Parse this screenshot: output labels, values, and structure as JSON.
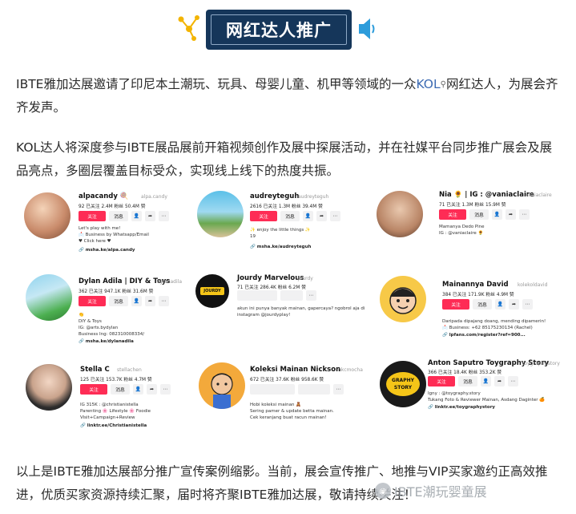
{
  "header": {
    "title": "网红达人推广",
    "left_icon": "network-icon",
    "right_icon": "speaker-icon",
    "accent": "#15365a",
    "deco_color": "#f3b400"
  },
  "paragraphs": {
    "p1_before": "IBTE雅加达展邀请了印尼本土潮玩、玩具、母婴儿童、机甲等领域的一众",
    "p1_link": "KOL",
    "p1_after": "网红达人，为展会齐齐发声。",
    "p2": "KOL达人将深度参与IBTE展品展前开箱视频创作及展中探展活动，并在社媒平台同步推广展会及展品亮点，多圈层覆盖目标受众，实现线上线下的热度共振。",
    "p3": "以上是IBTE雅加达展部分推广宣传案例缩影。当前，展会宣传推广、地推与VIP买家邀约正高效推进，优质买家资源持续汇聚，届时将齐聚IBTE雅加达展，敬请持续关注！"
  },
  "buttons": {
    "follow": "关注",
    "message": "消息"
  },
  "profiles": [
    {
      "name": "alpacandy 🍭",
      "handle": "alpa.candy",
      "stats": "92 已关注   2.4M 粉丝   50.4M 赞",
      "bio": "Let's play with me!\n📩 Business by Whatsapp/Email\n♥ Click here ♥",
      "link": "🔗 msha.ke/alpa.candy"
    },
    {
      "name": "audreyteguh",
      "handle": "audreyteguh",
      "stats": "2616 已关注   1.3M 粉丝   39.4M 赞",
      "bio": "✨ enjoy the little things ✨\n19",
      "link": "🔗 msha.ke/audreyteguh"
    },
    {
      "name": "Nia 🌻 | IG : @vaniaclaire",
      "handle": "vaniaclaire",
      "stats": "71 已关注   1.3M 粉丝   15.9M 赞",
      "bio": "Mamanya Dedo Pine\nIG : @vaniaclaire 🌻",
      "link": ""
    },
    {
      "name": "Dylan Adila | DIY & Toys",
      "handle": "dylanadila",
      "stats": "362 已关注   947.1K 粉丝   31.6M 赞",
      "bio": "👏\nDIY & Toys\nIG: @arts.bydylan\nBusiness Ing: 082310008334/",
      "link": "🔗 msha.ke/dylanadila"
    },
    {
      "name": "Jourdy Marvelous",
      "handle": "jourdy",
      "stats": "71 已关注   286.4K 粉丝   6.2M 赞",
      "bio": "akun ini punya banyak mainan, gapercaya? ngobrol aja di instagram @jourdyplay!",
      "link": ""
    },
    {
      "name": "Mainannya David",
      "handle": "kolekoldavid",
      "stats": "384 已关注   171.9K 粉丝   4.9M 赞",
      "bio": "Daripada dipajang doang, mending dipamerin!\n📩 Business: +62 85175230134 (Rachel)",
      "link": "🔗 lpfans.com/register?ref=900..."
    },
    {
      "name": "Stella C",
      "handle": "stellachen",
      "stats": "125 已关注   153.7K 粉丝   4.7M 赞",
      "bio": "IG 315K : @christianistella\nParenting 🌸 Lifestyle 🌸 Foodie\nVisit+Campaign+Review",
      "link": "🔗 linktr.ee/Christianistella"
    },
    {
      "name": "Koleksi Mainan Nickson",
      "handle": "nkcmocha",
      "stats": "672 已关注   37.6K 粉丝   958.6K 赞",
      "bio": "Hobi koleksi mainan 🧸\nSering pamer & update betta mainan.\nCek keranjang buat racun mainan!",
      "link": ""
    },
    {
      "name": "Anton Saputro Toygraphy Story",
      "handle": "toygraphy.story",
      "stats": "366 已关注   18.4K 粉丝   353.2K 赞",
      "bio": "Igny : @toygraphy.story\nTukang Foto & Reviewer Mainan, Asdang Daginter 🍊",
      "link": "🔗 linktr.ee/toygraphystory"
    }
  ],
  "watermark": {
    "text": "IBTE潮玩婴童展",
    "icon": "wechat-icon"
  },
  "colors": {
    "tiktok_red": "#fe2c55",
    "link_blue": "#3d6bb3"
  }
}
